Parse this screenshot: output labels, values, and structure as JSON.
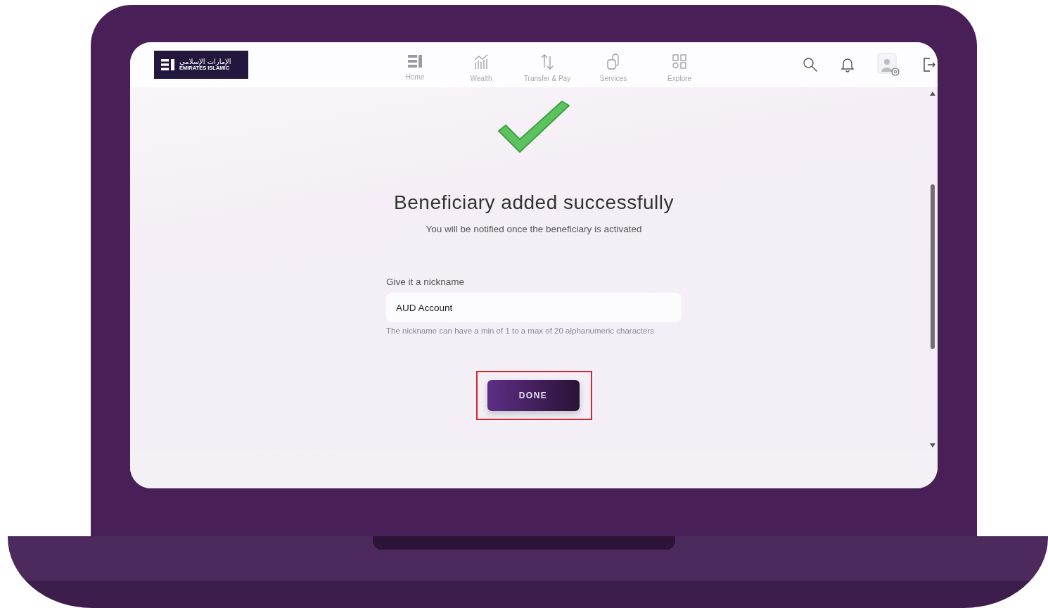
{
  "logo": {
    "arabic": "الإمارات الإسلامي",
    "english": "EMIRATES ISLAMIC"
  },
  "nav": [
    {
      "kind": "home",
      "label": "Home"
    },
    {
      "kind": "wealth",
      "label": "Wealth"
    },
    {
      "kind": "transfer",
      "label": "Transfer & Pay"
    },
    {
      "kind": "services",
      "label": "Services"
    },
    {
      "kind": "explore",
      "label": "Explore"
    }
  ],
  "success": {
    "title": "Beneficiary added successfully",
    "message": "You will be notified once the beneficiary is activated"
  },
  "nickname": {
    "label": "Give it a nickname",
    "value": "AUD Account",
    "hint": "The nickname can have a min of 1 to a max of 20 alphanumeric characters"
  },
  "done_button": "DONE"
}
